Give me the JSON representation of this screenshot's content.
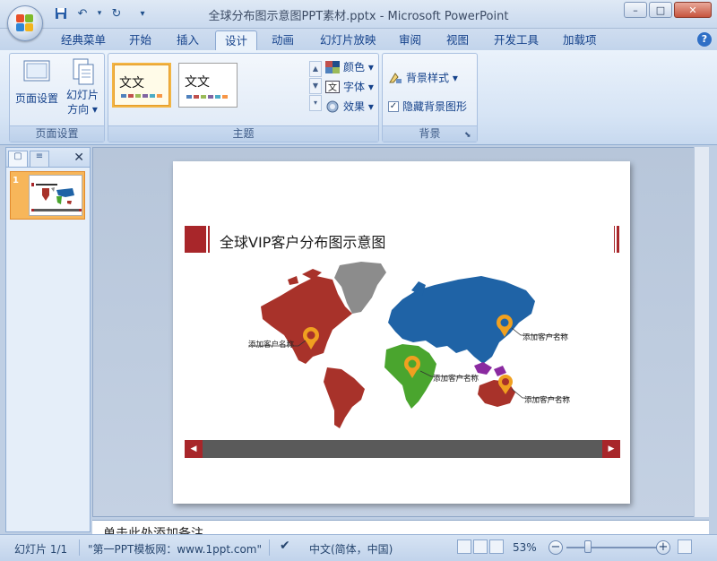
{
  "window": {
    "title": "全球分布图示意图PPT素材.pptx - Microsoft PowerPoint",
    "controls": {
      "minimize": "–",
      "maximize": "□",
      "close": "✕"
    }
  },
  "qat": {
    "save_icon": "save-icon",
    "undo": "↶",
    "redo": "↻",
    "more": "▾"
  },
  "tabs": [
    {
      "label": "经典菜单"
    },
    {
      "label": "开始"
    },
    {
      "label": "插入"
    },
    {
      "label": "设计"
    },
    {
      "label": "动画"
    },
    {
      "label": "幻灯片放映"
    },
    {
      "label": "审阅"
    },
    {
      "label": "视图"
    },
    {
      "label": "开发工具"
    },
    {
      "label": "加载项"
    }
  ],
  "active_tab": "设计",
  "ribbon": {
    "page_setup": {
      "group_label": "页面设置",
      "page_setup_label": "页面设置",
      "orientation_label_1": "幻灯片",
      "orientation_label_2": "方向 ▾"
    },
    "themes": {
      "group_label": "主题",
      "thumb1_text": "文文",
      "thumb2_text": "文文",
      "colors_label": "颜色 ▾",
      "fonts_label": "字体 ▾",
      "effects_label": "效果 ▾"
    },
    "background": {
      "group_label": "背景",
      "styles_label": "背景样式 ▾",
      "hide_graphics_label": "隐藏背景图形",
      "hide_graphics_checked": true
    }
  },
  "panel": {
    "close": "✕",
    "slide_number": "1"
  },
  "slide": {
    "title": "全球VIP客户分布图示意图",
    "callouts": [
      "添加客户名称",
      "添加客户名称",
      "添加客户名称",
      "添加客户名称"
    ],
    "bar_left": "◀",
    "bar_right": "▶",
    "colors": {
      "accent": "#a8262a",
      "americas": "#a8322a",
      "greenland": "#8c8c8c",
      "eurasia": "#1f63a6",
      "africa": "#4aa52e",
      "asia_islands": "#8a2aa0",
      "pin": "#f0a020"
    }
  },
  "notes": {
    "text": "单击此处添加备注"
  },
  "status": {
    "slide_info": "幻灯片 1/1",
    "theme": "\"第一PPT模板网：www.1ppt.com\"",
    "language": "中文(简体，中国)",
    "zoom": "53%"
  }
}
